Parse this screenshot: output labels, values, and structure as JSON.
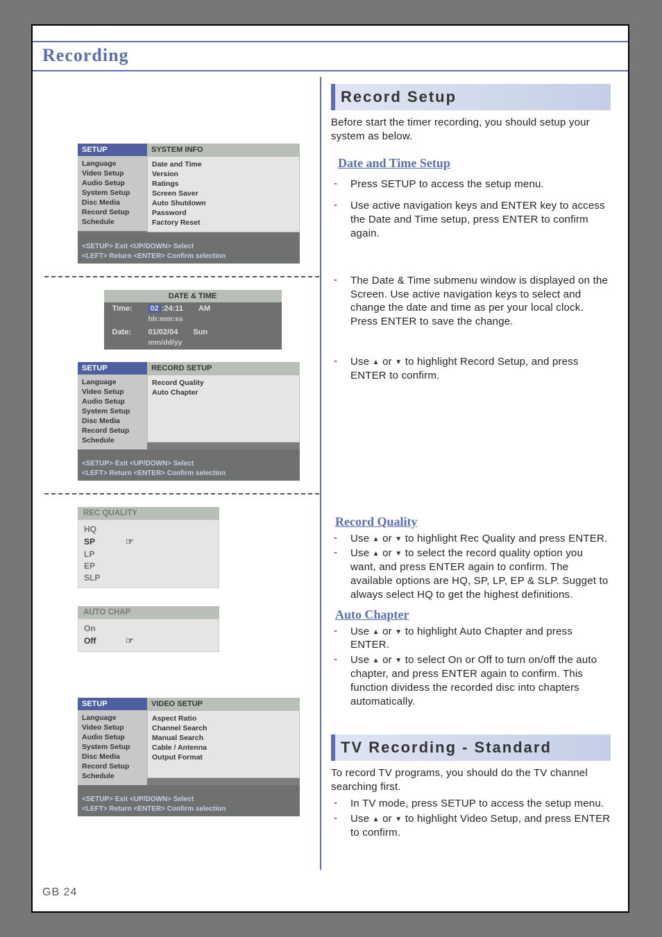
{
  "page": {
    "title": "Recording",
    "footer": "GB 24"
  },
  "osd_common": {
    "setup_hdr": "SETUP",
    "left_items": [
      "Language",
      "Video Setup",
      "Audio Setup",
      "System Setup",
      "Disc Media",
      "Record Setup",
      "Schedule"
    ],
    "help_line1": "<SETUP> Exit   <UP/DOWN> Select",
    "help_line2": "<LEFT> Return  <ENTER> Confirm selection"
  },
  "osd1": {
    "right_hdr": "SYSTEM INFO",
    "right_items": [
      "Date and Time",
      "Version",
      "Ratings",
      "Screen Saver",
      "Auto Shutdown",
      "Password",
      "Factory Reset"
    ]
  },
  "dt_panel": {
    "hdr": "DATE & TIME",
    "time_lbl": "Time:",
    "time_hl": "02",
    "time_rest": ":24:11",
    "time_ampm": "AM",
    "time_hint": "hh:mm:ss",
    "date_lbl": "Date:",
    "date_val": "01/02/04",
    "date_day": "Sun",
    "date_hint": "mm/dd/yy"
  },
  "osd2": {
    "right_hdr": "RECORD SETUP",
    "right_items": [
      "Record Quality",
      "Auto Chapter"
    ]
  },
  "rec_quality": {
    "hdr": "REC QUALITY",
    "items": [
      "HQ",
      "SP",
      "LP",
      "EP",
      "SLP"
    ],
    "selected": "SP"
  },
  "auto_chap": {
    "hdr": "AUTO CHAP",
    "items": [
      "On",
      "Off"
    ],
    "selected": "Off"
  },
  "osd3": {
    "right_hdr": "VIDEO SETUP",
    "right_items": [
      "Aspect Ratio",
      "Channel Search",
      "Manual Search",
      "Cable / Antenna",
      "Output Format"
    ]
  },
  "right": {
    "sec1_title": "Record Setup",
    "sec1_intro": "Before start the timer recording, you should setup your system as below.",
    "dt_head": "Date and Time Setup",
    "dt_b1": "Press SETUP to access the setup menu.",
    "dt_b2": "Use active navigation keys and ENTER key to access the Date and Time setup, press ENTER to confirm again.",
    "dt_b3": "The Date & Time submenu window is displayed on the Screen.  Use active navigation keys to select and change the date and time as per your local clock.  Press ENTER to save the change.",
    "dt_b4a": "Use ",
    "dt_b4b": " or ",
    "dt_b4c": " to highlight Record Setup, and press ENTER to confirm.",
    "rq_head": "Record Quality",
    "rq_b1a": "Use ",
    "rq_b1b": " or ",
    "rq_b1c": " to highlight Rec Quality and press ENTER.",
    "rq_b2a": "Use ",
    "rq_b2b": " or ",
    "rq_b2c": " to select the record quality option you want, and press ENTER again to confirm. The available options are HQ, SP, LP, EP & SLP. Sugget to always select HQ to get the highest definitions.",
    "ac_head": "Auto Chapter",
    "ac_b1a": "Use ",
    "ac_b1b": " or ",
    "ac_b1c": " to highlight Auto Chapter and press ENTER.",
    "ac_b2a": "Use ",
    "ac_b2b": " or ",
    "ac_b2c": " to select On or Off to turn on/off the auto chapter, and press ENTER again to confirm. This function dividess the recorded disc into chapters automatically.",
    "sec2_title": "TV Recording - Standard",
    "sec2_intro": "To record TV programs, you should do the TV channel searching first.",
    "sec2_b1": "In TV mode, press SETUP to access the setup menu.",
    "sec2_b2a": "Use ",
    "sec2_b2b": " or ",
    "sec2_b2c": " to highlight Video Setup, and press ENTER to confirm."
  }
}
